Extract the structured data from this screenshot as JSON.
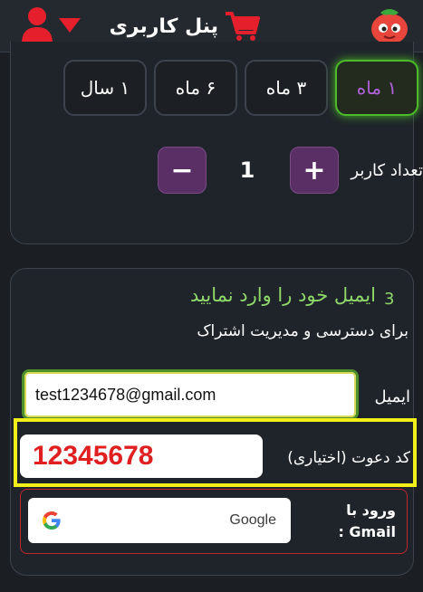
{
  "header": {
    "title": "پنل کاربری"
  },
  "durations": [
    {
      "label": "۱ سال",
      "active": false
    },
    {
      "label": "۶ ماه",
      "active": false
    },
    {
      "label": "۳ ماه",
      "active": false
    },
    {
      "label": "۱ ماه",
      "active": true
    }
  ],
  "user_count": {
    "label": "تعداد کاربر",
    "value": "1",
    "plus_label": "+",
    "minus_label": "−"
  },
  "step3": {
    "number": "3",
    "title": "ایمیل خود را وارد نمایید",
    "subtitle": "برای دسترسی و مدیریت اشتراک"
  },
  "email": {
    "label": "ایمیل",
    "value": "test1234678@gmail.com"
  },
  "invite": {
    "label": "کد دعوت (اختیاری)",
    "value": "12345678"
  },
  "gmail": {
    "label": "ورود با Gmail :",
    "button_label": "Google"
  },
  "colors": {
    "accent_green": "#4cbb2a",
    "accent_purple": "#5a2f66",
    "highlight_yellow": "#f2ee1a",
    "error_red": "#e02020"
  }
}
